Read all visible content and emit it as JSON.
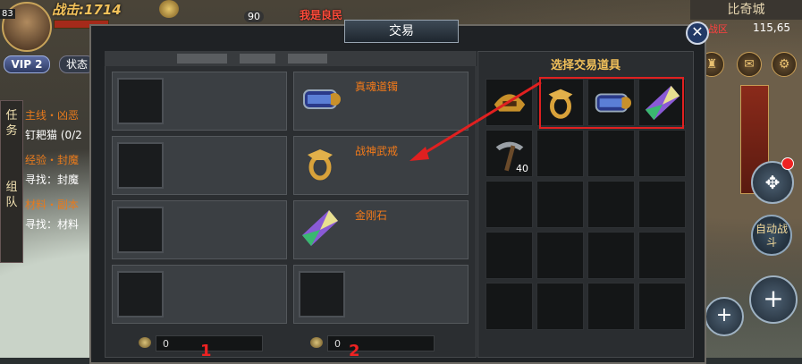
{
  "player": {
    "level": "83",
    "power": "战击:1714",
    "vip": "VIP 2",
    "state_button": "状态"
  },
  "side_tabs": [
    "任务",
    "组队"
  ],
  "quests": [
    {
      "title": "主线・凶恶",
      "detail": "钉耙猫 (0/2"
    },
    {
      "title": "经验・封魔",
      "detail": "寻找：封魔"
    },
    {
      "title": "材料・副本",
      "detail": "寻找：材料"
    }
  ],
  "nearby": {
    "level": "90",
    "name": "我是良民"
  },
  "map": {
    "name": "比奇城",
    "zone": "战区",
    "coords": "115,65"
  },
  "auto_battle": "自动战斗",
  "trade": {
    "title": "交易",
    "close_icon": "close-icon",
    "offer_items": [
      {
        "name": "真魂道镯",
        "icon": "bracelet-icon"
      },
      {
        "name": "战神武戒",
        "icon": "ring-icon"
      },
      {
        "name": "金刚石",
        "icon": "diamond-icon"
      },
      {
        "name": "",
        "icon": ""
      }
    ],
    "left_gold": "0",
    "right_gold": "0",
    "markers": [
      "1",
      "2"
    ],
    "select_title": "选择交易道具",
    "inventory": [
      {
        "icon": "helmet-icon",
        "qty": ""
      },
      {
        "icon": "ring-icon",
        "qty": ""
      },
      {
        "icon": "bracelet-icon",
        "qty": ""
      },
      {
        "icon": "diamond-icon",
        "qty": ""
      },
      {
        "icon": "pickaxe-icon",
        "qty": "40"
      }
    ]
  },
  "colors": {
    "item_name": "#f27a1a",
    "highlight": "#e02020",
    "title_gold": "#f2c15a"
  }
}
